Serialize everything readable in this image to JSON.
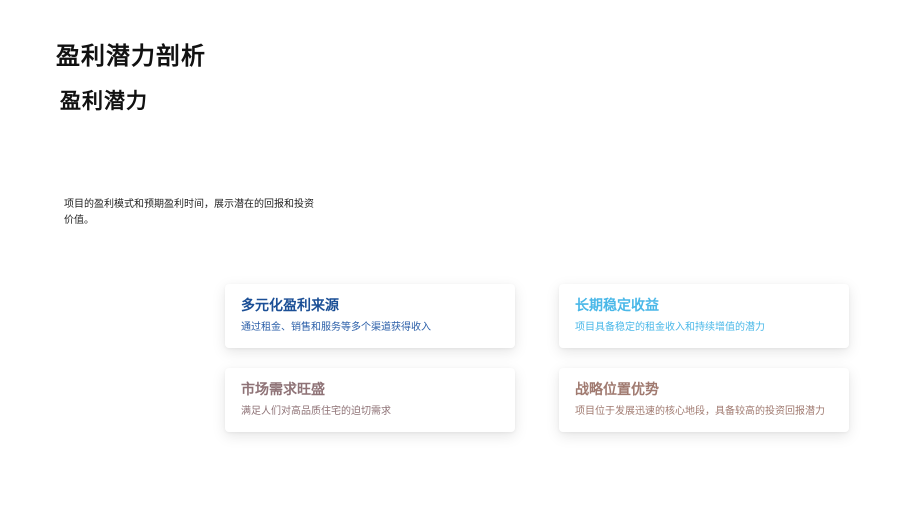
{
  "page": {
    "title": "盈利潜力剖析",
    "subtitle": "盈利潜力",
    "description": "项目的盈利模式和预期盈利时间，展示潜在的回报和投资价值。"
  },
  "cards": [
    {
      "title": "多元化盈利来源",
      "text": "通过租金、销售和服务等多个渠道获得收入",
      "title_color": "#1b4f96",
      "text_color": "#2a5ea8"
    },
    {
      "title": "长期稳定收益",
      "text": "项目具备稳定的租金收入和持续增值的潜力",
      "title_color": "#4ab8e8",
      "text_color": "#4ab8e8"
    },
    {
      "title": "市场需求旺盛",
      "text": "满足人们对高品质住宅的迫切需求",
      "title_color": "#8e7276",
      "text_color": "#8e7276"
    },
    {
      "title": "战略位置优势",
      "text": "项目位于发展迅速的核心地段，具备较高的投资回报潜力",
      "title_color": "#a07a70",
      "text_color": "#a07a70"
    }
  ]
}
